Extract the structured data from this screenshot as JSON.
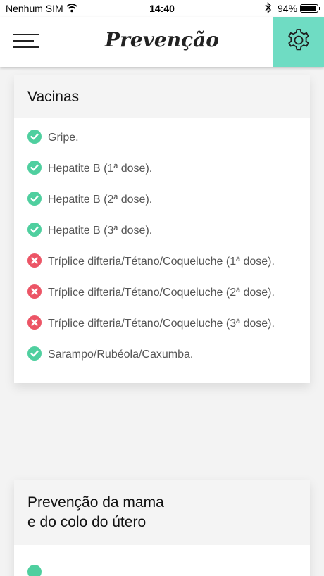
{
  "status_bar": {
    "carrier": "Nenhum SIM",
    "time": "14:40",
    "battery": "94%",
    "battery_level": 0.94
  },
  "header": {
    "title": "Prevenção",
    "menu_icon": "hamburger-menu-icon",
    "settings_icon": "gear-icon",
    "accent_color": "#6fdcc3"
  },
  "vaccines": {
    "title": "Vacinas",
    "items": [
      {
        "label": "Gripe.",
        "status": "done"
      },
      {
        "label": "Hepatite B (1ª dose).",
        "status": "done"
      },
      {
        "label": "Hepatite B (2ª dose).",
        "status": "done"
      },
      {
        "label": "Hepatite B (3ª dose).",
        "status": "done"
      },
      {
        "label": "Tríplice difteria/Tétano/Coqueluche (1ª dose).",
        "status": "missing"
      },
      {
        "label": "Tríplice difteria/Tétano/Coqueluche (2ª dose).",
        "status": "missing"
      },
      {
        "label": "Tríplice difteria/Tétano/Coqueluche (3ª dose).",
        "status": "missing"
      },
      {
        "label": "Sarampo/Rubéola/Caxumba.",
        "status": "done"
      }
    ]
  },
  "breast_prevention": {
    "title_line1": "Prevenção da mama",
    "title_line2": "e do colo do útero"
  },
  "colors": {
    "done": "#4fcf9f",
    "missing": "#ec5566"
  }
}
